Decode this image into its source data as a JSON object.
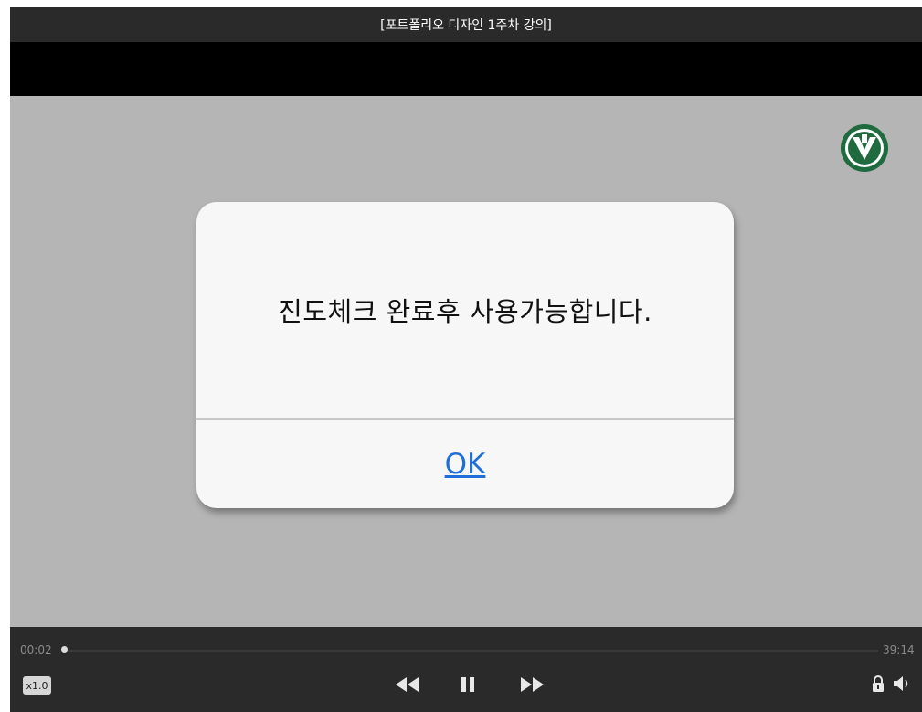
{
  "header": {
    "title": "[포트폴리오 디자인 1주차 강의]"
  },
  "alert": {
    "message": "진도체크 완료후 사용가능합니다.",
    "ok_label": "OK"
  },
  "controls": {
    "current_time": "00:02",
    "total_time": "39:14",
    "speed_label": "x1.0",
    "progress_percent": 0.1,
    "icons": [
      "rewind-icon",
      "pause-icon",
      "fast-forward-icon",
      "lock-icon",
      "volume-icon"
    ]
  },
  "colors": {
    "title_bar": "#2a2a2a",
    "video_background": "#b5b5b5",
    "link_blue": "#1e6fd9",
    "logo_green": "#1f6b3f"
  },
  "logo": {
    "name": "university-seal-logo"
  }
}
